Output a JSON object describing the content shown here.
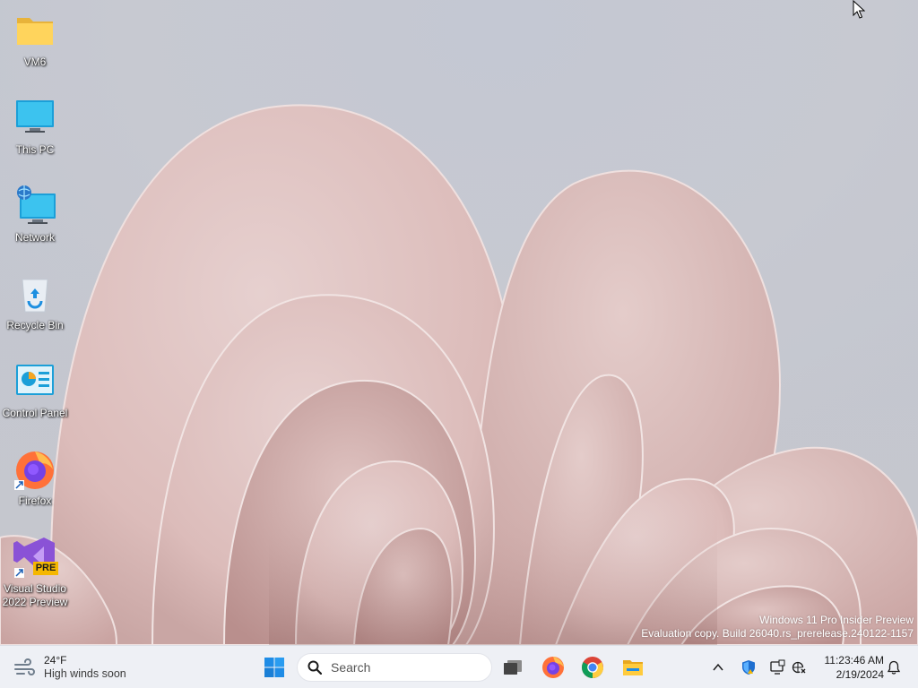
{
  "desktop_icons": [
    {
      "label": "VM6",
      "icon": "folder-icon"
    },
    {
      "label": "This PC",
      "icon": "monitor-icon"
    },
    {
      "label": "Network",
      "icon": "network-icon"
    },
    {
      "label": "Recycle Bin",
      "icon": "recycle-bin-icon"
    },
    {
      "label": "Control Panel",
      "icon": "control-panel-icon"
    },
    {
      "label": "Firefox",
      "icon": "firefox-icon"
    },
    {
      "label": "Visual Studio 2022 Preview",
      "icon": "visual-studio-icon",
      "badge": "PRE"
    }
  ],
  "watermark": {
    "line1": "Windows 11 Pro Insider Preview",
    "line2": "Evaluation copy. Build 26040.rs_prerelease.240122-1157"
  },
  "taskbar": {
    "weather": {
      "temperature": "24°F",
      "condition": "High winds soon",
      "icon": "wind-icon"
    },
    "search": {
      "placeholder": "Search"
    },
    "pinned": [
      "start-icon",
      "task-view-icon",
      "firefox-icon",
      "chrome-icon",
      "file-explorer-icon"
    ],
    "tray_icons": [
      "chevron-up-icon",
      "security-shield-icon",
      "display-icon",
      "network-disconnected-icon"
    ],
    "clock": {
      "time": "11:23:46 AM",
      "date": "2/19/2024"
    },
    "notification_icon": "bell-icon"
  },
  "colors": {
    "wallpaper_bg": "#c6c8d0",
    "petal": "#e3c8c6",
    "taskbar": "#eef0f5",
    "accent": "#0078d4"
  }
}
